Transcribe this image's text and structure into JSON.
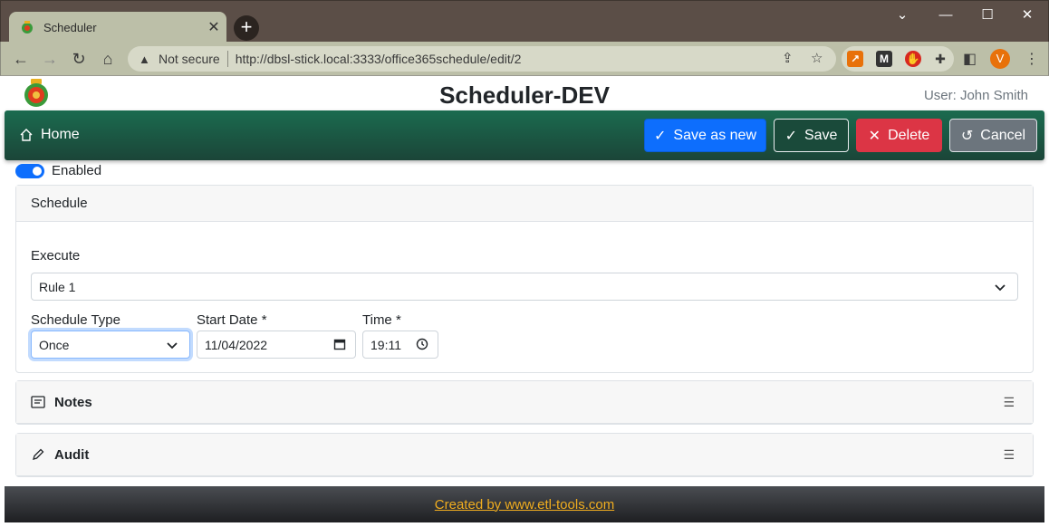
{
  "browser": {
    "tab_title": "Scheduler",
    "tab_close": "✕",
    "new_tab": "+",
    "security_label": "Not secure",
    "url": "http://dbsl-stick.local:3333/office365schedule/edit/2",
    "profile_initial": "V"
  },
  "app": {
    "title": "Scheduler-DEV",
    "user": "User: John Smith"
  },
  "nav": {
    "home_label": "Home",
    "save_as_new_label": "Save as new",
    "save_label": "Save",
    "delete_label": "Delete",
    "cancel_label": "Cancel"
  },
  "enabled": {
    "label": "Enabled",
    "value": true
  },
  "schedule": {
    "header": "Schedule",
    "execute_label": "Execute",
    "execute_value": "Rule 1",
    "schedule_type_label": "Schedule Type",
    "schedule_type_value": "Once",
    "start_date_label": "Start Date *",
    "start_date_value": "11/04/2022",
    "time_label": "Time *",
    "time_value": "19:11"
  },
  "sections": {
    "notes_label": "Notes",
    "audit_label": "Audit",
    "toggle_glyph": "☰"
  },
  "footer": {
    "link_text": "Created by www.etl-tools.com"
  },
  "colors": {
    "primary": "#0d6efd",
    "danger": "#dc3545",
    "secondary": "#6c757d",
    "nav_green": "#1b5a45",
    "footer_link": "#f0ad1f"
  }
}
